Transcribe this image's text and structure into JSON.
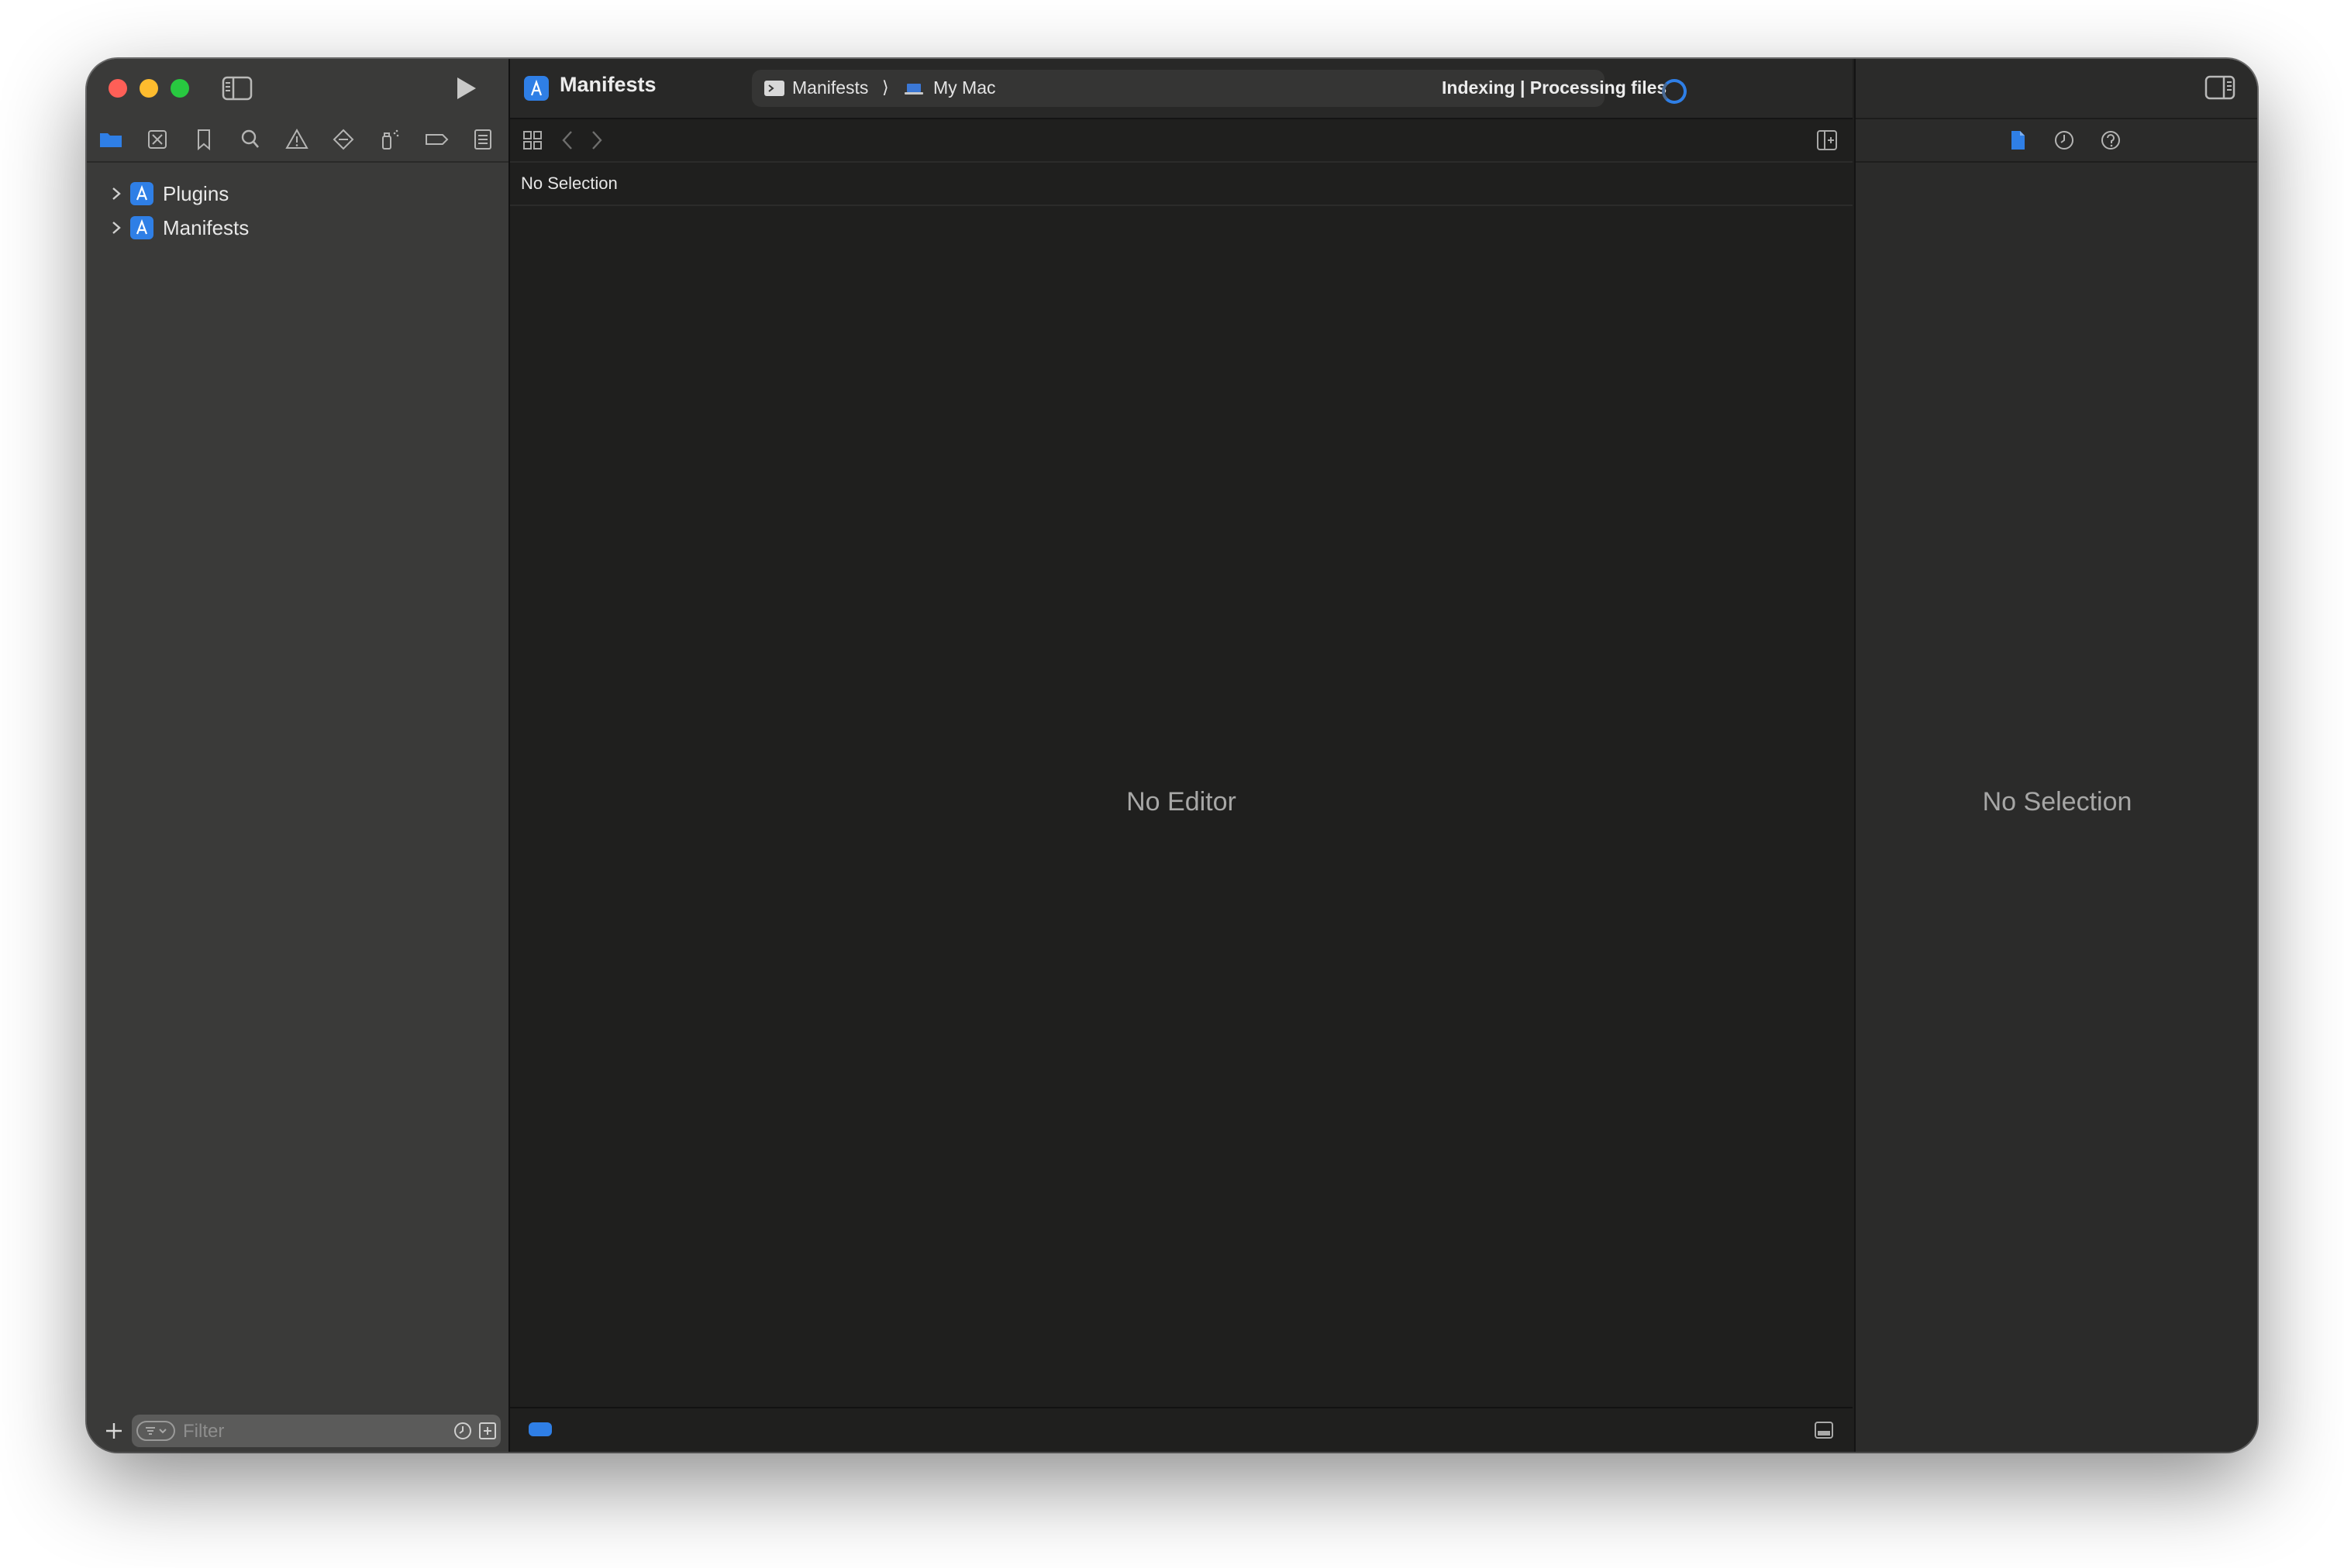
{
  "window": {
    "scheme_title": "Manifests"
  },
  "navigator": {
    "tabs": [
      {
        "icon": "folder-icon",
        "active": true
      },
      {
        "icon": "source-control-icon"
      },
      {
        "icon": "bookmark-icon"
      },
      {
        "icon": "search-icon"
      },
      {
        "icon": "warning-icon"
      },
      {
        "icon": "test-diamond-icon"
      },
      {
        "icon": "debug-spray-icon"
      },
      {
        "icon": "breakpoint-tag-icon"
      },
      {
        "icon": "report-icon"
      }
    ],
    "items": [
      {
        "label": "Plugins"
      },
      {
        "label": "Manifests"
      }
    ],
    "filter_placeholder": "Filter"
  },
  "activity": {
    "scheme": "Manifests",
    "separator": "⟩",
    "destination": "My Mac",
    "status": "Indexing | Processing files"
  },
  "editor": {
    "path_label": "No Selection",
    "empty_message": "No Editor"
  },
  "inspector": {
    "empty_message": "No Selection"
  },
  "colors": {
    "accent": "#2f7fe6",
    "sidebar_bg": "#3a3a39",
    "editor_bg": "#1f1f1e",
    "inspector_bg": "#2b2b2a",
    "close": "#fe5f57",
    "minimize": "#febc2e",
    "maximize": "#28c840"
  }
}
